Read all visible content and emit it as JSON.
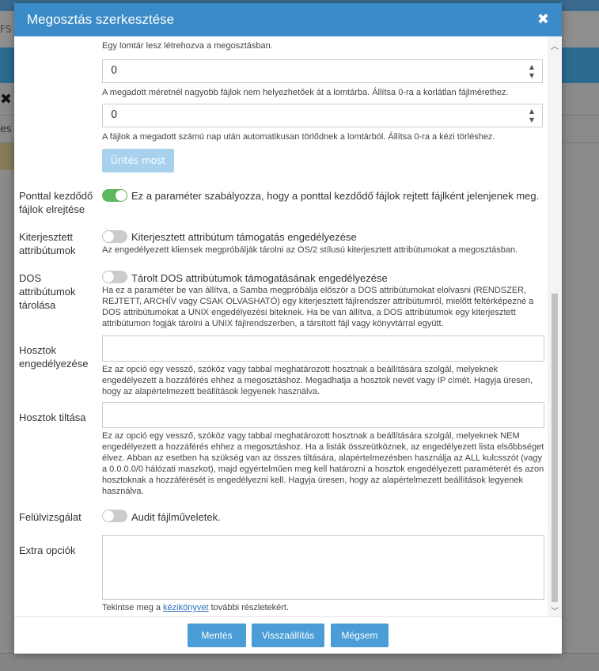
{
  "background": {
    "fragment_fs": "FS",
    "fragment_x": "✖",
    "fragment_es": "es"
  },
  "modal": {
    "title": "Megosztás szerkesztése",
    "close_icon": "close-icon"
  },
  "recycle": {
    "cut_label": "Egy lomtár lesz létrehozva a megosztásban.",
    "max_size_value": "0",
    "max_size_help": "A megadott méretnél nagyobb fájlok nem helyezhetőek át a lomtárba. Állítsa 0-ra a korlátlan fájlmérethez.",
    "max_days_value": "0",
    "max_days_help": "A fájlok a megadott számú nap után automatikusan törlődnek a lomtárból. Állítsa 0-ra a kézi törléshez.",
    "empty_now_label": "Ürítés most"
  },
  "hide_dot_files": {
    "label": "Ponttal kezdődő fájlok elrejtése",
    "enabled": true,
    "text": "Ez a paraméter szabályozza, hogy a ponttal kezdődő fájlok rejtett fájlként jelenjenek meg."
  },
  "ext_attrs": {
    "label": "Kiterjesztett attribútumok",
    "enabled": false,
    "text": "Kiterjesztett attribútum támogatás engedélyezése",
    "help": "Az engedélyezett kliensek megpróbálják tárolni az OS/2 stílusú kiterjesztett attribútumokat a megosztásban."
  },
  "dos_attrs": {
    "label": "DOS attribútumok tárolása",
    "enabled": false,
    "text": "Tárolt DOS attribútumok támogatásának engedélyezése",
    "help": "Ha ez a paraméter be van állítva, a Samba megpróbálja először a DOS attribútumokat elolvasni (RENDSZER, REJTETT, ARCHÍV vagy CSAK OLVASHATÓ) egy kiterjesztett fájlrendszer attribútumról, mielőtt feltérképezné a DOS attribútumokat a UNIX engedélyezési biteknek. Ha be van állítva, a DOS attribútumok egy kiterjesztett attribútumon fogják tárolni a UNIX fájlrendszerben, a társított fájl vagy könyvtárral együtt."
  },
  "hosts_allow": {
    "label": "Hosztok engedélyezése",
    "value": "",
    "help": "Ez az opció egy vessző, szóköz vagy tabbal meghatározott hosztnak a beállítására szolgál, melyeknek engedélyezett a hozzáférés ehhez a megosztáshoz. Megadhatja a hosztok nevét vagy IP címét. Hagyja üresen, hogy az alapértelmezett beállítások legyenek használva."
  },
  "hosts_deny": {
    "label": "Hosztok tiltása",
    "value": "",
    "help": "Ez az opció egy vessző, szóköz vagy tabbal meghatározott hosztnak a beállítására szolgál, melyeknek NEM engedélyezett a hozzáférés ehhez a megosztáshoz. Ha a listák összeütköznek, az engedélyezett lista elsőbbséget élvez. Abban az esetben ha szükség van az összes tiltására, alapértelmezésben használja az ALL kulcsszót (vagy a 0.0.0.0/0 hálózati maszkot), majd egyértelműen meg kell határozni a hosztok engedélyezett paraméterét és azon hosztoknak a hozzáférését is engedélyezni kell. Hagyja üresen, hogy az alapértelmezett beállítások legyenek használva."
  },
  "audit": {
    "label": "Felülvizsgálat",
    "enabled": false,
    "text": "Audit fájlműveletek."
  },
  "extra": {
    "label": "Extra opciók",
    "value": "",
    "help_prefix": "Tekintse meg a ",
    "help_link": "kézikönyvet",
    "help_suffix": " további részletekért."
  },
  "footer": {
    "save_label": "Mentés",
    "reset_label": "Visszaállítás",
    "cancel_label": "Mégsem"
  },
  "colors": {
    "header": "#3a8bc7",
    "button": "#4a9dd6",
    "toggle_on": "#5cb85c",
    "toggle_off": "#cccccc"
  }
}
